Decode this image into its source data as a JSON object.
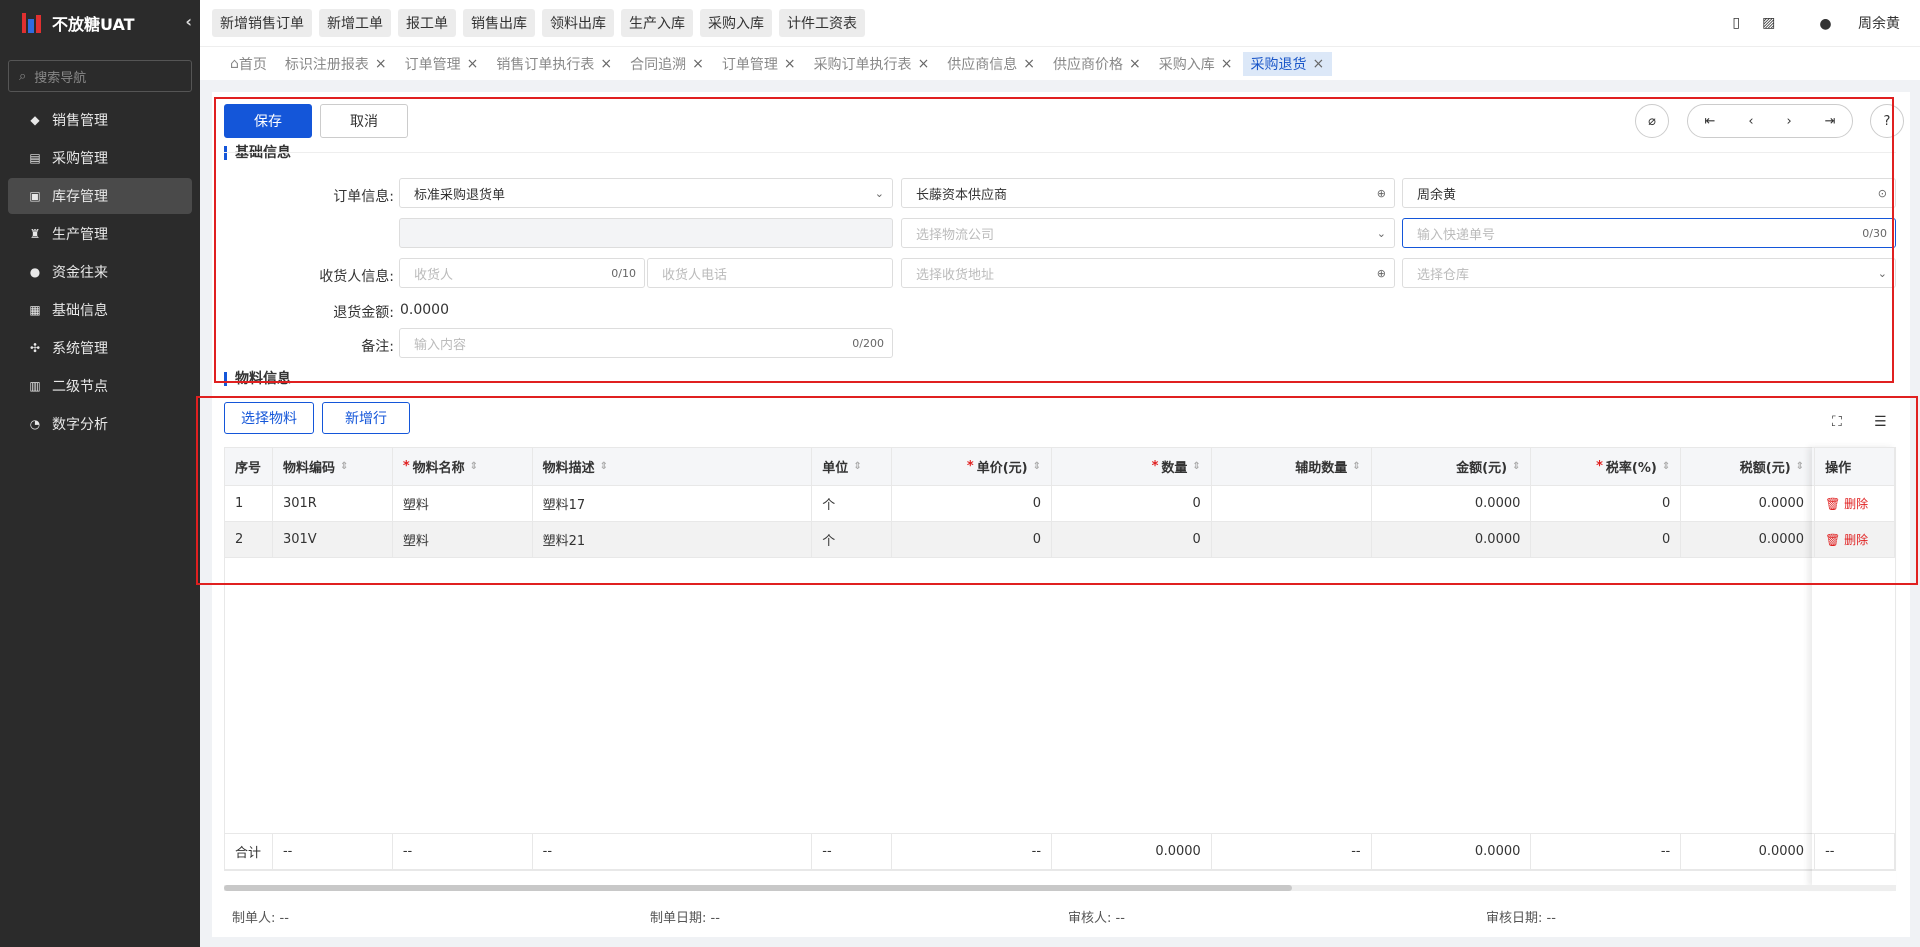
{
  "app": {
    "title": "不放糖UAT",
    "collapse": "‹"
  },
  "nav": {
    "search_placeholder": "搜索导航",
    "items": [
      {
        "label": "销售管理",
        "icon": "tag-icon"
      },
      {
        "label": "采购管理",
        "icon": "cart-icon"
      },
      {
        "label": "库存管理",
        "icon": "warehouse-icon"
      },
      {
        "label": "生产管理",
        "icon": "factory-icon"
      },
      {
        "label": "资金往来",
        "icon": "money-icon"
      },
      {
        "label": "基础信息",
        "icon": "grid-icon"
      },
      {
        "label": "系统管理",
        "icon": "settings-icon"
      },
      {
        "label": "二级节点",
        "icon": "document-icon"
      },
      {
        "label": "数字分析",
        "icon": "pie-chart-icon"
      }
    ]
  },
  "quick": [
    "新增销售订单",
    "新增工单",
    "报工单",
    "销售出库",
    "领料出库",
    "生产入库",
    "采购入库",
    "计件工资表"
  ],
  "user": {
    "name": "周余黄"
  },
  "tabs": [
    "首页",
    "标识注册报表",
    "订单管理",
    "销售订单执行表",
    "合同追溯",
    "订单管理",
    "采购订单执行表",
    "供应商信息",
    "供应商价格",
    "采购入库",
    "采购退货"
  ],
  "actions": {
    "save": "保存",
    "cancel": "取消"
  },
  "sections": {
    "basic": "基础信息",
    "material": "物料信息"
  },
  "form": {
    "order_label": "订单信息:",
    "order_type": "标准采购退货单",
    "supplier": "长藤资本供应商",
    "owner": "周余黄",
    "logistics_ph": "选择物流公司",
    "tracking_ph": "输入快递单号",
    "tracking_count": "0/30",
    "receiver_label": "收货人信息:",
    "receiver_ph": "收货人",
    "receiver_count": "0/10",
    "phone_ph": "收货人电话",
    "address_ph": "选择收货地址",
    "warehouse_ph": "选择仓库",
    "amount_label": "退货金额:",
    "amount": "0.0000",
    "remark_label": "备注:",
    "remark_ph": "输入内容",
    "remark_count": "0/200"
  },
  "grid_buttons": {
    "select": "选择物料",
    "add": "新增行"
  },
  "columns": [
    "序号",
    "物料编码",
    "物料名称",
    "物料描述",
    "单位",
    "单价(元)",
    "数量",
    "辅助数量",
    "金额(元)",
    "税率(%)",
    "税额(元)",
    "操作"
  ],
  "rows": [
    {
      "no": "1",
      "code": "301R",
      "name": "塑料",
      "desc": "塑料17",
      "unit": "个",
      "price": "0",
      "qty": "0",
      "aux": "",
      "amount": "0.0000",
      "rate": "0",
      "tax": "0.0000",
      "op": "删除"
    },
    {
      "no": "2",
      "code": "301V",
      "name": "塑料",
      "desc": "塑料21",
      "unit": "个",
      "price": "0",
      "qty": "0",
      "aux": "",
      "amount": "0.0000",
      "rate": "0",
      "tax": "0.0000",
      "op": "删除"
    }
  ],
  "totals": {
    "label": "合计",
    "code": "--",
    "name": "--",
    "desc": "--",
    "unit": "--",
    "price": "--",
    "qty": "0.0000",
    "aux": "--",
    "amount": "0.0000",
    "rate": "--",
    "tax": "0.0000",
    "op": "--"
  },
  "meta": {
    "creator": "制单人: --",
    "create_date": "制单日期: --",
    "auditor": "审核人: --",
    "audit_date": "审核日期: --"
  },
  "colors": {
    "primary": "#1456d9",
    "sidebar": "#2b2b2b",
    "highlight": "#e02020"
  }
}
